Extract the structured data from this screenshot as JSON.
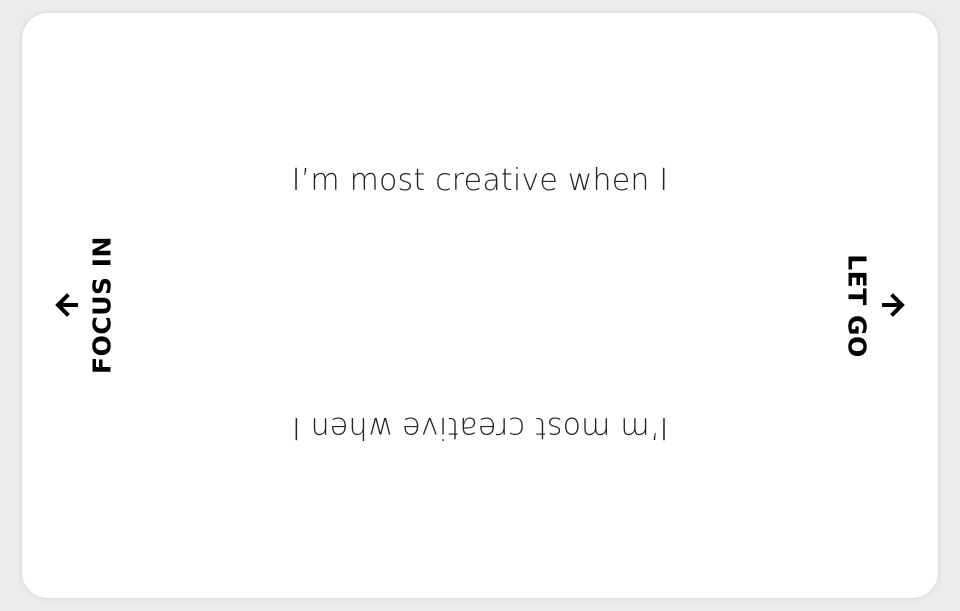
{
  "card": {
    "prompt_top": "I’m most creative when I",
    "prompt_bottom": "I’m most creative when I",
    "left_label": "FOCUS IN",
    "right_label": "LET GO",
    "left_icon": "arrow-left-icon",
    "right_icon": "arrow-right-icon"
  },
  "colors": {
    "background": "#ececec",
    "card": "#ffffff",
    "text": "#000000"
  }
}
